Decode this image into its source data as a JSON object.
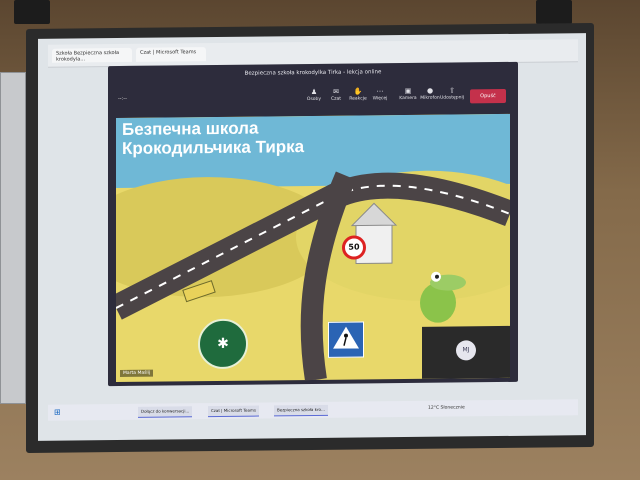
{
  "window": {
    "title": "Bezpieczna szkoła krokodylka Tirka - lekcja online",
    "timer": "--:--"
  },
  "browser": {
    "tabs": [
      "Szkoła Bezpieczna szkoła krokodyla…",
      "Czat | Microsoft Teams"
    ]
  },
  "toolbar": {
    "items": [
      {
        "label": "Osoby",
        "icon": "people-icon"
      },
      {
        "label": "Czat",
        "icon": "chat-icon"
      },
      {
        "label": "Reakcje",
        "icon": "reaction-icon"
      },
      {
        "label": "Więcej",
        "icon": "more-icon"
      },
      {
        "label": "Kamera",
        "icon": "camera-icon"
      },
      {
        "label": "Mikrofon",
        "icon": "mic-icon"
      },
      {
        "label": "Udostępnij",
        "icon": "share-icon"
      }
    ],
    "leave_label": "Opuść"
  },
  "slide": {
    "heading_line1": "Безпечна школа",
    "heading_line2": "Крокодильчика Тирка",
    "speed_limit": "50"
  },
  "presenter": {
    "name": "Marta Maślij",
    "self_initials": "MJ"
  },
  "taskbar": {
    "tasks": [
      "Dołącz do konwersacji…",
      "Czat | Microsoft Teams",
      "Bezpieczna szkoła kro…"
    ],
    "weather": "12°C Słonecznie"
  },
  "colors": {
    "leave_button": "#c4314b",
    "teams_bg": "#2d2c3c"
  }
}
